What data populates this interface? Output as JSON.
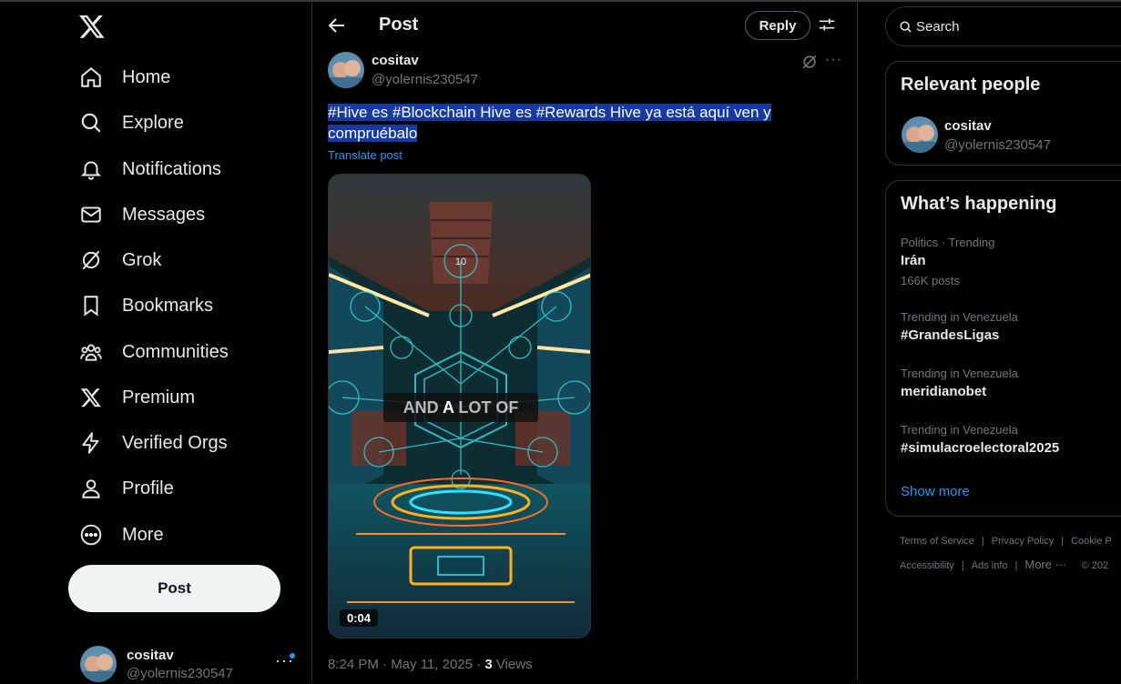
{
  "sidebar": {
    "logo": "x-logo-icon",
    "nav": [
      {
        "label": "Home",
        "icon": "home-icon"
      },
      {
        "label": "Explore",
        "icon": "search-icon"
      },
      {
        "label": "Notifications",
        "icon": "bell-icon"
      },
      {
        "label": "Messages",
        "icon": "mail-icon"
      },
      {
        "label": "Grok",
        "icon": "grok-icon"
      },
      {
        "label": "Bookmarks",
        "icon": "bookmark-icon"
      },
      {
        "label": "Communities",
        "icon": "communities-icon"
      },
      {
        "label": "Premium",
        "icon": "x-logo-icon"
      },
      {
        "label": "Verified Orgs",
        "icon": "lightning-icon"
      },
      {
        "label": "Profile",
        "icon": "person-icon"
      },
      {
        "label": "More",
        "icon": "more-circle-icon"
      }
    ],
    "post_button": "Post",
    "account": {
      "name": "cositav",
      "handle": "@yolernis230547",
      "more": "···"
    }
  },
  "main": {
    "header": {
      "title": "Post",
      "reply_button": "Reply"
    },
    "post": {
      "author_name": "cositav",
      "author_handle": "@yolernis230547",
      "text_line1": "#Hive es #Blockchain Hive es #Rewards Hive ya está aquí ven y",
      "text_line2": "compruébalo",
      "translate": "Translate post",
      "media": {
        "overlay_text_1": "AND",
        "overlay_text_2": "A",
        "overlay_text_3": "LOT OF",
        "duration": "0:04",
        "badge_number": "10"
      },
      "meta_time": "8:24 PM · May 11, 2025 · ",
      "views_count": "3",
      "views_label": " Views"
    }
  },
  "right": {
    "search_placeholder": "Search",
    "relevant": {
      "title": "Relevant people",
      "name": "cositav",
      "handle": "@yolernis230547"
    },
    "happening": {
      "title": "What’s happening",
      "trends": [
        {
          "context": "Politics · Trending",
          "title": "Irán",
          "count": "166K posts"
        },
        {
          "context": "Trending in Venezuela",
          "title": "#GrandesLigas",
          "count": ""
        },
        {
          "context": "Trending in Venezuela",
          "title": "meridianobet",
          "count": ""
        },
        {
          "context": "Trending in Venezuela",
          "title": "#simulacroelectoral2025",
          "count": ""
        }
      ],
      "show_more": "Show more"
    },
    "footer": {
      "terms": "Terms of Service",
      "privacy": "Privacy Policy",
      "cookie": "Cookie P",
      "accessibility": "Accessibility",
      "ads": "Ads info",
      "more": "More ···",
      "copyright": "© 202"
    }
  },
  "colors": {
    "background": "#000000",
    "accent": "#1d9bf0",
    "text": "#e7e9ea",
    "muted": "#71767b",
    "border": "#2f3336",
    "highlight": "#1739a3"
  }
}
